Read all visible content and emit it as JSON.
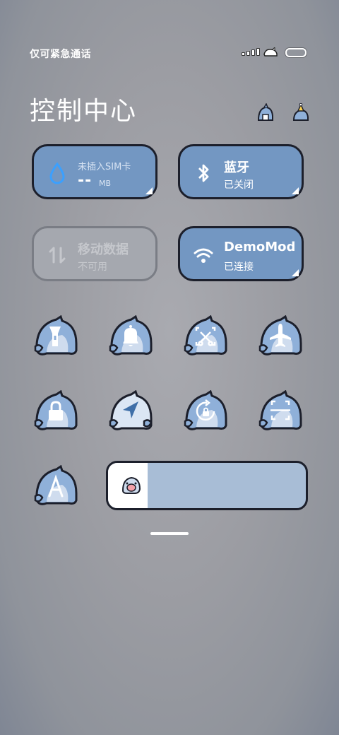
{
  "status_bar": {
    "carrier_text": "仅可紧急通话"
  },
  "header": {
    "title": "控制中心",
    "left_icon": "shark-edit-icon",
    "right_icon": "shark-settings-icon"
  },
  "tiles": {
    "sim": {
      "label": "未插入SIM卡",
      "value": "--",
      "unit": "MB",
      "icon": "data-usage-drop-icon"
    },
    "bluetooth": {
      "label": "蓝牙",
      "status": "已关闭",
      "icon": "bluetooth-icon"
    },
    "mobile_data": {
      "label": "移动数据",
      "status": "不可用",
      "icon": "mobile-data-icon"
    },
    "wifi": {
      "label": "DemoMod",
      "status": "已连接",
      "icon": "wifi-icon"
    }
  },
  "toggles": [
    {
      "name": "flashlight",
      "icon": "flashlight-icon"
    },
    {
      "name": "sound",
      "icon": "bell-icon"
    },
    {
      "name": "screenshot",
      "icon": "screenshot-icon"
    },
    {
      "name": "airplane",
      "icon": "airplane-icon"
    },
    {
      "name": "lock-screen",
      "icon": "lock-icon"
    },
    {
      "name": "location",
      "icon": "location-icon"
    },
    {
      "name": "rotation-lock",
      "icon": "rotation-lock-icon"
    },
    {
      "name": "scanner",
      "icon": "scan-icon"
    },
    {
      "name": "auto-brightness",
      "icon": "letter-a-icon"
    }
  ],
  "brightness": {
    "level": 0.2,
    "icon": "shark-face-icon"
  },
  "colors": {
    "tile": "#7397c2",
    "border": "#1c1f2b",
    "shark_body": "#8fb0d9",
    "shark_belly": "#ffffff"
  }
}
